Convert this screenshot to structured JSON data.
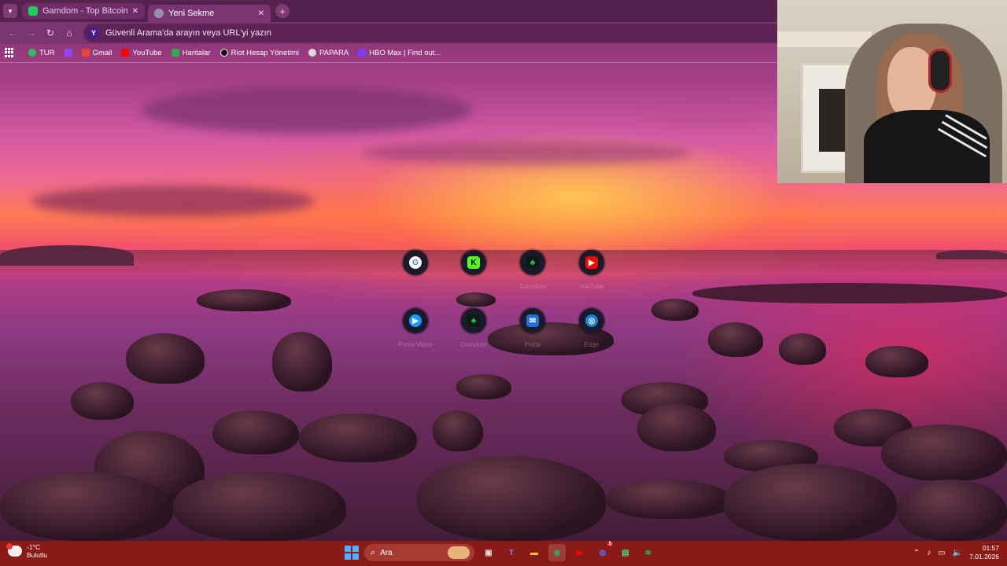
{
  "browser": {
    "tabs": [
      {
        "title": "Gamdom - Top Bitcoin & Crypto",
        "active": false,
        "favicon": "gamdom-icon",
        "color": "#1fcf5a"
      },
      {
        "title": "Yeni Sekme",
        "active": true,
        "favicon": "newtab-icon",
        "color": "#9a8fa8"
      }
    ],
    "omnibox": {
      "placeholder": "Güvenli Arama'da arayın veya URL'yi yazın",
      "engine_icon": "Y"
    },
    "bookmarks": [
      {
        "label": "TUR",
        "icon": "star-icon",
        "color": "#27c35a"
      },
      {
        "label": "",
        "icon": "twitch-icon",
        "color": "#9146ff"
      },
      {
        "label": "Gmail",
        "icon": "gmail-icon",
        "color": "#ea4335"
      },
      {
        "label": "YouTube",
        "icon": "youtube-icon",
        "color": "#ff0000"
      },
      {
        "label": "Haritalar",
        "icon": "maps-icon",
        "color": "#34a853"
      },
      {
        "label": "Riot Hesap Yönetimi",
        "icon": "riot-icon",
        "color": "#111111"
      },
      {
        "label": "PAPARA",
        "icon": "papara-icon",
        "color": "#dddddd"
      },
      {
        "label": "HBO Max | Find out...",
        "icon": "hbo-icon",
        "color": "#7b3cff"
      }
    ]
  },
  "shortcuts": [
    {
      "label": "",
      "icon": "G",
      "name": "google-shortcut",
      "fg": "#4285f4",
      "bg": "#ffffff"
    },
    {
      "label": "",
      "icon": "K",
      "name": "kick-shortcut",
      "fg": "#000000",
      "bg": "#53fc18"
    },
    {
      "label": "Gamdom",
      "icon": "♣",
      "name": "gamdom-shortcut",
      "fg": "#1fcf5a",
      "bg": "#0b1a12"
    },
    {
      "label": "YouTube",
      "icon": "▶",
      "name": "youtube-shortcut",
      "fg": "#ffffff",
      "bg": "#ff0000"
    },
    {
      "label": "Prime Video",
      "icon": "▶",
      "name": "primevideo-shortcut",
      "fg": "#ffffff",
      "bg": "#1a98ff"
    },
    {
      "label": "Gamdom",
      "icon": "♣",
      "name": "gamdom2-shortcut",
      "fg": "#1fcf5a",
      "bg": "#0b1a12"
    },
    {
      "label": "Posta",
      "icon": "✉",
      "name": "mail-shortcut",
      "fg": "#ffffff",
      "bg": "#1e6fd9"
    },
    {
      "label": "Edge",
      "icon": "◎",
      "name": "edge-shortcut",
      "fg": "#ffffff",
      "bg": "#1682d4"
    }
  ],
  "taskbar": {
    "weather": {
      "temp": "-1°C",
      "condition": "Bulutlu"
    },
    "search_label": "Ara",
    "apps": [
      {
        "name": "task-view-icon",
        "glyph": "▣",
        "color": "#dddddd"
      },
      {
        "name": "teams-icon",
        "glyph": "T",
        "color": "#7b83eb"
      },
      {
        "name": "file-explorer-icon",
        "glyph": "▬",
        "color": "#f5c342"
      },
      {
        "name": "chrome-icon",
        "glyph": "◉",
        "color": "#34a853"
      },
      {
        "name": "youtube-app-icon",
        "glyph": "▶",
        "color": "#ff0000"
      },
      {
        "name": "discord-icon",
        "glyph": "◍",
        "color": "#5865f2",
        "badge": "5"
      },
      {
        "name": "android-app-icon",
        "glyph": "▤",
        "color": "#3ddc84"
      },
      {
        "name": "spotify-icon",
        "glyph": "≋",
        "color": "#1db954"
      }
    ],
    "clock": {
      "time": "01:57",
      "date": "7.01.2026"
    }
  }
}
